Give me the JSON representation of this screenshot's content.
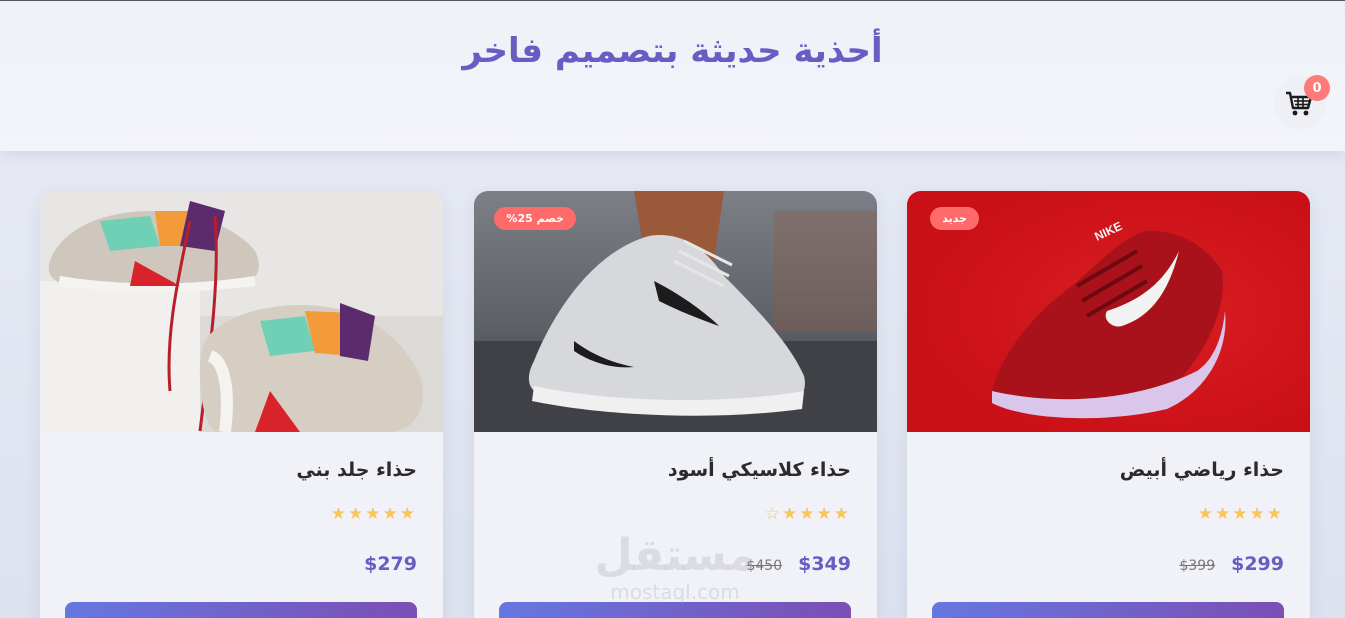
{
  "header": {
    "title": "أحذية حديثة بتصميم فاخر"
  },
  "cart": {
    "icon": "shopping-cart-icon",
    "count": "0"
  },
  "products": [
    {
      "title": "حذاء رياضي أبيض",
      "badge": "جديد",
      "rating": "★★★★★",
      "price": "$299",
      "old_price": "$399"
    },
    {
      "title": "حذاء كلاسيكي أسود",
      "badge": "خصم 25%",
      "rating": "★★★★☆",
      "price": "$349",
      "old_price": "$450"
    },
    {
      "title": "حذاء جلد بني",
      "badge": "",
      "rating": "★★★★★",
      "price": "$279",
      "old_price": ""
    }
  ],
  "watermark": {
    "arabic": "مستقل",
    "latin": "mostaql.com"
  },
  "colors": {
    "accent": "#6b5cc4",
    "badge": "#ff6b6b",
    "star": "#f7c65a",
    "button_start": "#6677e0",
    "button_end": "#7b4fb4"
  }
}
